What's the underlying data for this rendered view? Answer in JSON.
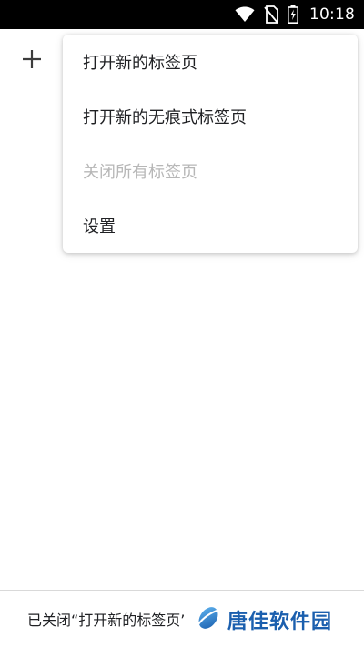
{
  "status_bar": {
    "time": "10:18",
    "icons": [
      "wifi-icon",
      "no-sim-icon",
      "battery-charging-icon"
    ]
  },
  "tab_switcher": {
    "new_tab_icon": "plus-icon"
  },
  "menu": {
    "items": [
      {
        "label": "打开新的标签页",
        "enabled": true
      },
      {
        "label": "打开新的无痕式标签页",
        "enabled": true
      },
      {
        "label": "关闭所有标签页",
        "enabled": false
      },
      {
        "label": "设置",
        "enabled": true
      }
    ]
  },
  "snackbar": {
    "message": "已关闭“打开新的标签页”"
  },
  "watermark": {
    "text": "唐佳软件园"
  },
  "colors": {
    "status_bar_bg": "#000000",
    "menu_text": "#202124",
    "menu_text_disabled": "#b7b7b7",
    "watermark_blue": "#1b5fae"
  }
}
